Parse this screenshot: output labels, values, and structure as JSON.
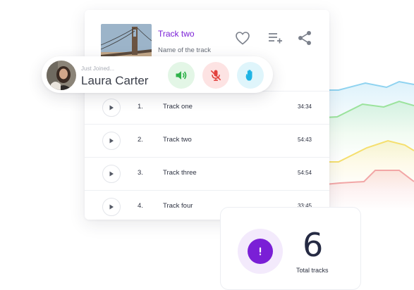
{
  "now_playing": {
    "title": "Track two",
    "subtitle": "Name of the track"
  },
  "icons": {
    "like": "heart-icon",
    "add_to_playlist": "playlist-add-icon",
    "share": "share-icon",
    "play": "play-icon",
    "speaker": "volume-icon",
    "mic_muted": "mic-off-icon",
    "raise_hand": "hand-icon",
    "alert": "alert-icon"
  },
  "tracks": [
    {
      "num": "1.",
      "name": "Track one",
      "duration": "34:34"
    },
    {
      "num": "2.",
      "name": "Track two",
      "duration": "54:43"
    },
    {
      "num": "3.",
      "name": "Track three",
      "duration": "54:54"
    },
    {
      "num": "4.",
      "name": "Track four",
      "duration": "33:45"
    }
  ],
  "join_notice": {
    "label": "Just Joined...",
    "name": "Laura Carter"
  },
  "stats": {
    "count": "6",
    "label": "Total tracks"
  },
  "colors": {
    "accent": "#7a1fd6",
    "speaker_bg": "#e3f6e6",
    "speaker_fg": "#2fb24a",
    "mic_bg": "#fde3e3",
    "mic_fg": "#e2403d",
    "hand_bg": "#dff5fb",
    "hand_fg": "#1fb4e4"
  }
}
